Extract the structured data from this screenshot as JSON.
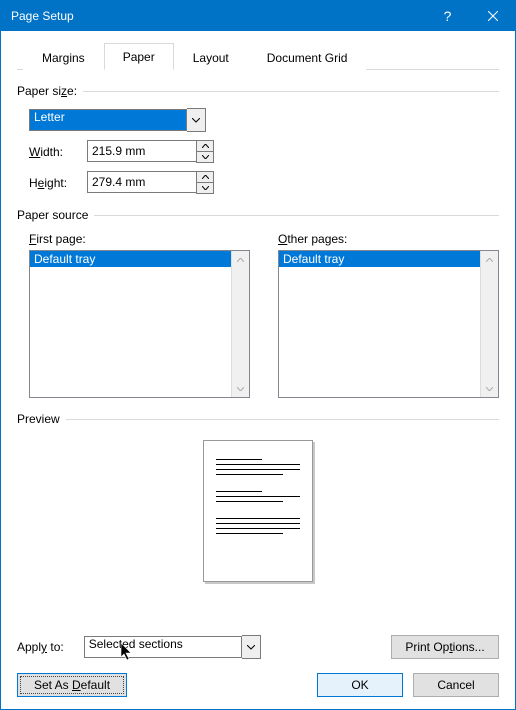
{
  "title": "Page Setup",
  "tabs": {
    "margins": "Margins",
    "paper": "Paper",
    "layout": "Layout",
    "grid": "Document Grid"
  },
  "paper_size": {
    "label_prefix": "Paper si",
    "label_u": "z",
    "label_suffix": "e:",
    "value": "Letter",
    "width_u": "W",
    "width_rest": "idth:",
    "width_val": "215.9 mm",
    "height_pre": "H",
    "height_u": "e",
    "height_rest": "ight:",
    "height_val": "279.4 mm"
  },
  "paper_source": {
    "label": "Paper source",
    "first_u": "F",
    "first_rest": "irst page:",
    "first_val": "Default tray",
    "other_u": "O",
    "other_rest": "ther pages:",
    "other_val": "Default tray"
  },
  "preview_label": "Preview",
  "apply": {
    "pre": "Appl",
    "u": "y",
    "post": " to:",
    "value": "Selected sections"
  },
  "buttons": {
    "print_pre": "Print Op",
    "print_u": "t",
    "print_post": "ions...",
    "default_pre": "Set As ",
    "default_u": "D",
    "default_post": "efault",
    "ok": "OK",
    "cancel": "Cancel"
  }
}
